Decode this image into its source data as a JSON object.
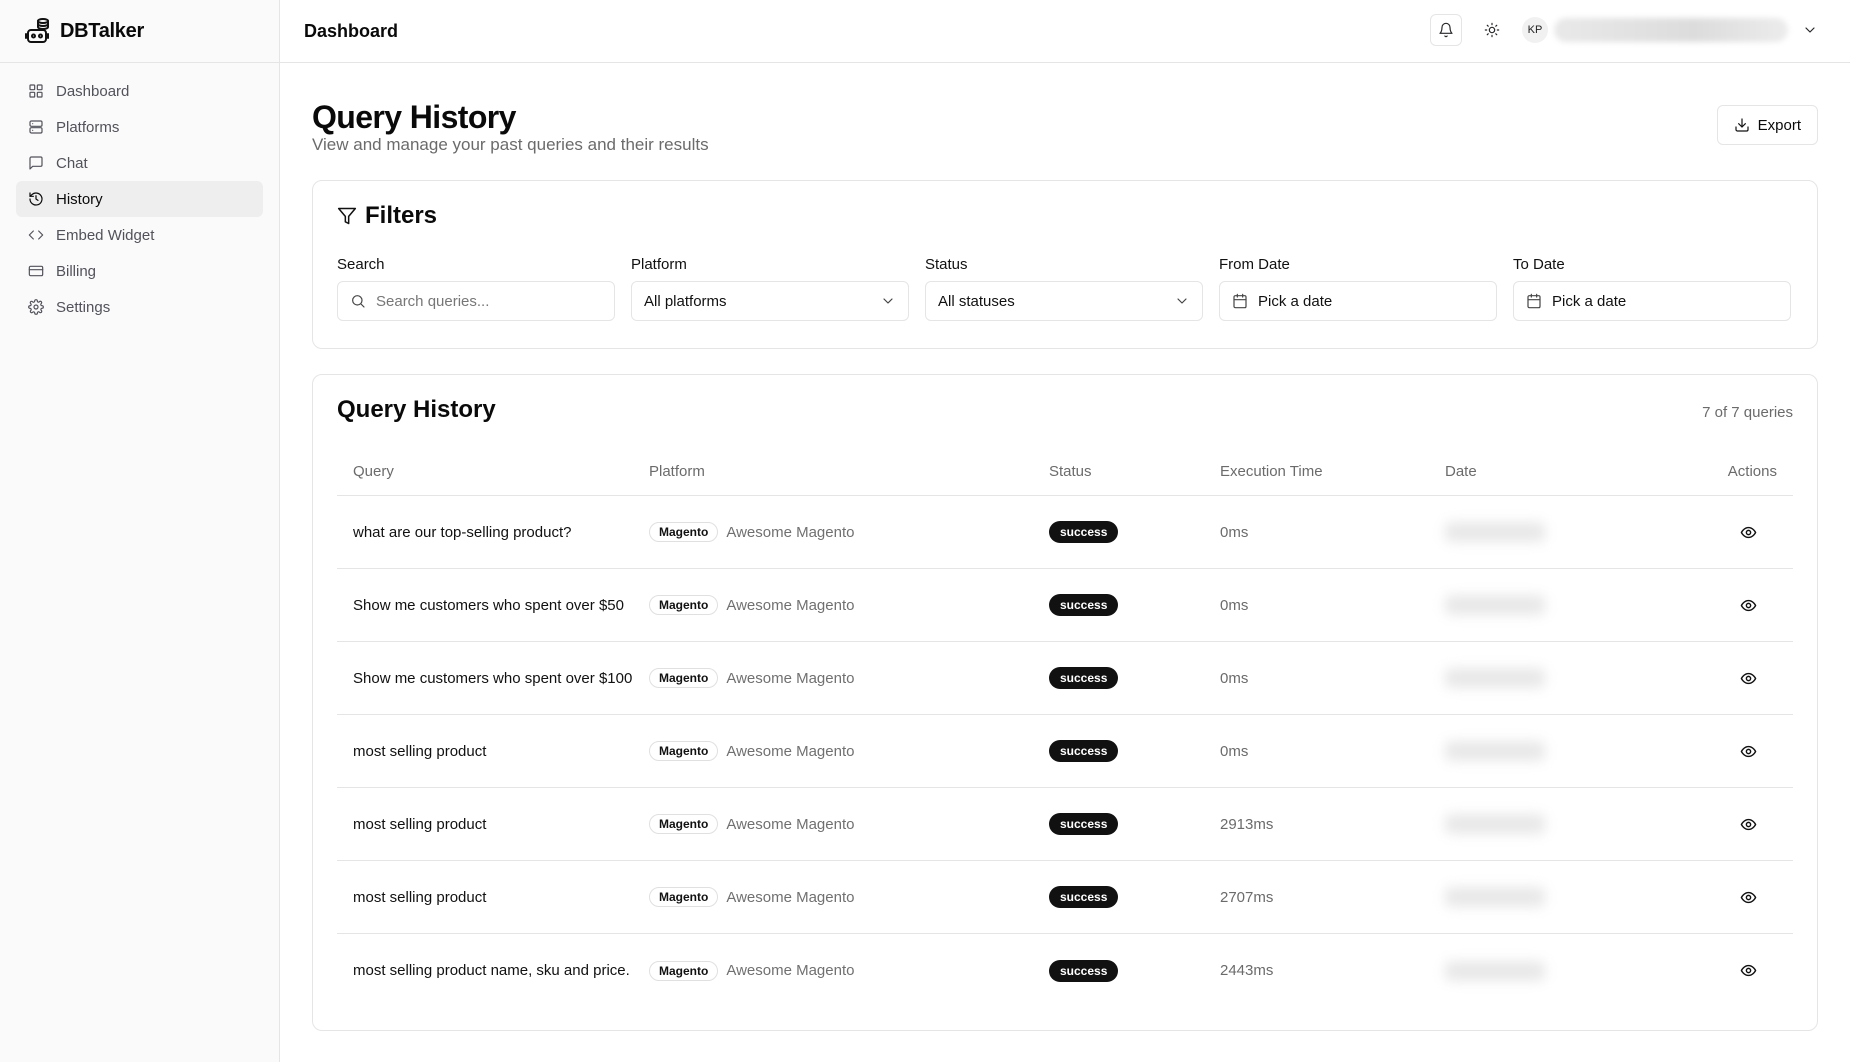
{
  "app": {
    "name": "DBTalker"
  },
  "sidebar": {
    "items": [
      {
        "label": "Dashboard",
        "icon": "dashboard-grid-icon"
      },
      {
        "label": "Platforms",
        "icon": "server-icon"
      },
      {
        "label": "Chat",
        "icon": "chat-bubble-icon"
      },
      {
        "label": "History",
        "icon": "history-icon",
        "active": true
      },
      {
        "label": "Embed Widget",
        "icon": "code-icon"
      },
      {
        "label": "Billing",
        "icon": "credit-card-icon"
      },
      {
        "label": "Settings",
        "icon": "gear-icon"
      }
    ]
  },
  "header": {
    "title": "Dashboard",
    "user_initials": "KP"
  },
  "page": {
    "title": "Query History",
    "subtitle": "View and manage your past queries and their results",
    "export_label": "Export"
  },
  "filters": {
    "title": "Filters",
    "search": {
      "label": "Search",
      "placeholder": "Search queries..."
    },
    "platform": {
      "label": "Platform",
      "value": "All platforms"
    },
    "status": {
      "label": "Status",
      "value": "All statuses"
    },
    "from_date": {
      "label": "From Date",
      "value": "Pick a date"
    },
    "to_date": {
      "label": "To Date",
      "value": "Pick a date"
    }
  },
  "history": {
    "title": "Query History",
    "count": "7 of 7 queries",
    "columns": [
      "Query",
      "Platform",
      "Status",
      "Execution Time",
      "Date",
      "Actions"
    ],
    "rows": [
      {
        "query": "what are our top-selling product?",
        "platform_tag": "Magento",
        "platform_name": "Awesome Magento",
        "status": "success",
        "time": "0ms"
      },
      {
        "query": "Show me customers who spent over $50",
        "platform_tag": "Magento",
        "platform_name": "Awesome Magento",
        "status": "success",
        "time": "0ms"
      },
      {
        "query": "Show me customers who spent over $100",
        "platform_tag": "Magento",
        "platform_name": "Awesome Magento",
        "status": "success",
        "time": "0ms"
      },
      {
        "query": "most selling product",
        "platform_tag": "Magento",
        "platform_name": "Awesome Magento",
        "status": "success",
        "time": "0ms"
      },
      {
        "query": "most selling product",
        "platform_tag": "Magento",
        "platform_name": "Awesome Magento",
        "status": "success",
        "time": "2913ms"
      },
      {
        "query": "most selling product",
        "platform_tag": "Magento",
        "platform_name": "Awesome Magento",
        "status": "success",
        "time": "2707ms"
      },
      {
        "query": "most selling product name, sku and price.",
        "platform_tag": "Magento",
        "platform_name": "Awesome Magento",
        "status": "success",
        "time": "2443ms"
      }
    ]
  }
}
